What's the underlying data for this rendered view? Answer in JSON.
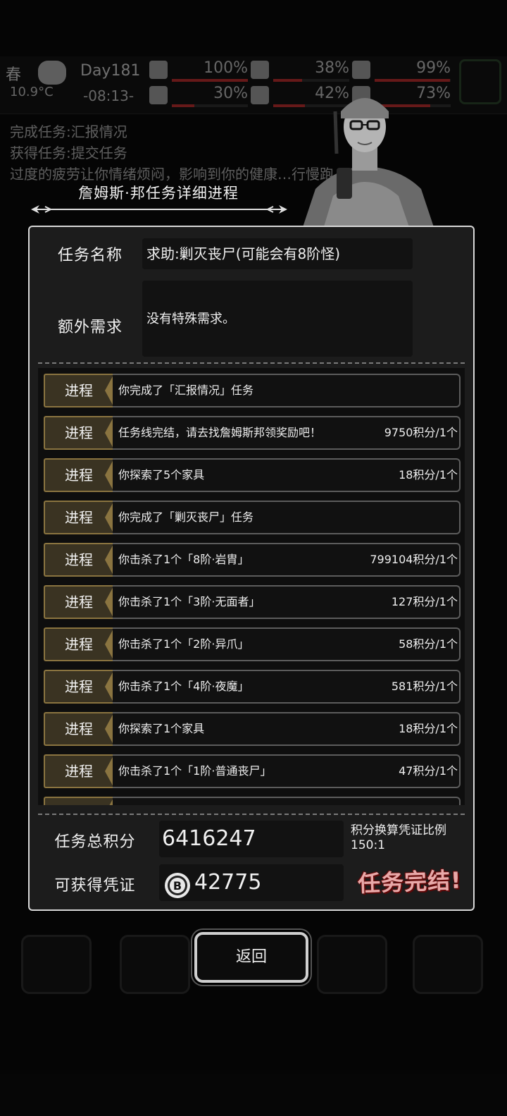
{
  "background": {
    "hud": {
      "season": "春",
      "temperature": "10.9°C",
      "day": "Day181",
      "time": "-08:13-",
      "stats": [
        {
          "icon": "medkit-icon",
          "value": "100%"
        },
        {
          "icon": "stomach-icon",
          "value": "38%"
        },
        {
          "icon": "bottle-icon",
          "value": "99%"
        },
        {
          "icon": "thermometer-icon",
          "value": "30%"
        },
        {
          "icon": "water-drop-icon",
          "value": "42%"
        },
        {
          "icon": "mood-icon",
          "value": "73%"
        }
      ]
    },
    "log": [
      "完成任务:汇报情况",
      "获得任务:提交任务",
      "过度的疲劳让你情绪烦闷，影响到你的健康…行慢跑..."
    ]
  },
  "dialog": {
    "title": "詹姆斯·邦任务详细进程",
    "task_name_label": "任务名称",
    "task_name": "求助:剿灭丧尸(可能会有8阶怪)",
    "extra_label": "额外需求",
    "extra_value": "没有特殊需求。",
    "progress_tag": "进程",
    "progress": [
      {
        "text": "你完成了「汇报情况」任务",
        "points": ""
      },
      {
        "text": "任务线完结，请去找詹姆斯邦领奖励吧！",
        "points": "9750积分/1个"
      },
      {
        "text": "你探索了5个家具",
        "points": "18积分/1个"
      },
      {
        "text": "你完成了「剿灭丧尸」任务",
        "points": ""
      },
      {
        "text": "你击杀了1个「8阶·岩胄」",
        "points": "799104积分/1个"
      },
      {
        "text": "你击杀了1个「3阶·无面者」",
        "points": "127积分/1个"
      },
      {
        "text": "你击杀了1个「2阶·异爪」",
        "points": "58积分/1个"
      },
      {
        "text": "你击杀了1个「4阶·夜魔」",
        "points": "581积分/1个"
      },
      {
        "text": "你探索了1个家具",
        "points": "18积分/1个"
      },
      {
        "text": "你击杀了1个「1阶·普通丧尸」",
        "points": "47积分/1个"
      }
    ],
    "total_label": "任务总积分",
    "total_value": "6416247",
    "rate_label": "积分换算凭证比例",
    "rate_value": "150:1",
    "voucher_label": "可获得凭证",
    "voucher_value": "42775",
    "status": "任务完结!",
    "back_button": "返回"
  },
  "colors": {
    "tag_fill": "#3a3322",
    "tag_border": "#8a7440",
    "status_text": "#e8a8a8"
  }
}
